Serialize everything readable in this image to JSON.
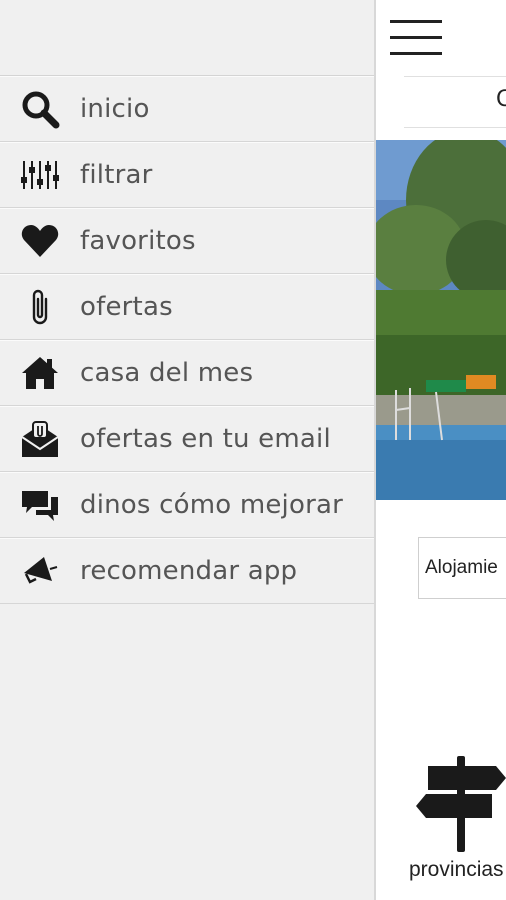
{
  "drawer": {
    "items": [
      {
        "label": "inicio",
        "icon": "search-icon"
      },
      {
        "label": "filtrar",
        "icon": "sliders-icon"
      },
      {
        "label": "favoritos",
        "icon": "heart-icon"
      },
      {
        "label": "ofertas",
        "icon": "paperclip-icon"
      },
      {
        "label": "casa del mes",
        "icon": "house-icon"
      },
      {
        "label": "ofertas en tu email",
        "icon": "email-offer-icon"
      },
      {
        "label": "dinos cómo mejorar",
        "icon": "chat-bubbles-icon"
      },
      {
        "label": "recomendar app",
        "icon": "megaphone-icon"
      }
    ]
  },
  "main": {
    "tab_partial": "C",
    "select_value": "Alojamie",
    "provinces_label": "provincias"
  },
  "colors": {
    "drawer_bg": "#f0f0f0",
    "label_text": "#555555",
    "icon": "#1a1a1a",
    "pool_water": "#4a8fc4"
  }
}
